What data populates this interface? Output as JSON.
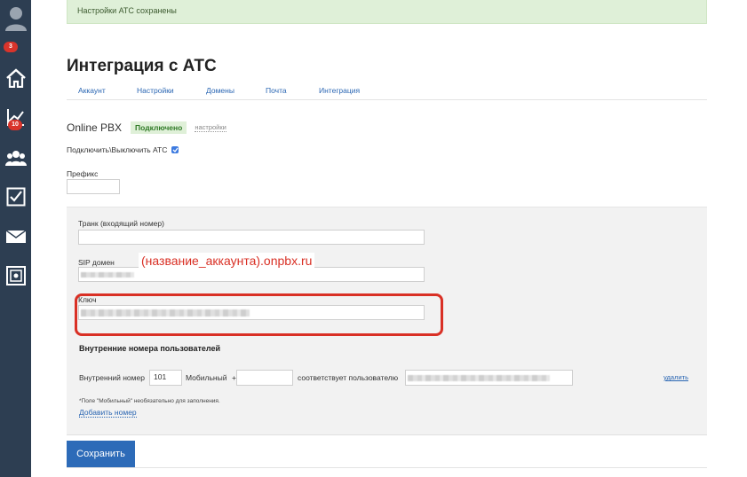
{
  "sidebar": {
    "items": [
      {
        "icon": "user-avatar-icon"
      },
      {
        "icon": "home-icon",
        "badge": "3"
      },
      {
        "icon": "chart-icon",
        "badge": "10"
      },
      {
        "icon": "users-icon"
      },
      {
        "icon": "tasks-checkbox-icon"
      },
      {
        "icon": "mail-icon"
      },
      {
        "icon": "safe-icon"
      }
    ],
    "colors": {
      "background": "#2d3e52",
      "badge": "#d9342b"
    }
  },
  "alert": {
    "text": "Настройки АТС сохранены"
  },
  "page": {
    "title": "Интеграция с АТС"
  },
  "tabs": [
    {
      "label": "Аккаунт"
    },
    {
      "label": "Настройки"
    },
    {
      "label": "Домены"
    },
    {
      "label": "Почта"
    },
    {
      "label": "Интеграция"
    }
  ],
  "pbx": {
    "name": "Online PBX",
    "status": "Подключено",
    "settings_link": "настройки"
  },
  "toggle": {
    "label": "Подключить\\Выключить АТС",
    "checked": true
  },
  "prefix": {
    "label": "Префикс",
    "value": ""
  },
  "trunk": {
    "label": "Транк (входящий номер)",
    "value": ""
  },
  "sip_domain": {
    "label": "SIP домен"
  },
  "annotation": {
    "text": "(название_аккаунта).onpbx.ru"
  },
  "key": {
    "label": "Ключ"
  },
  "internal": {
    "section_title": "Внутренние номера пользователей",
    "ext_label": "Внутренний номер",
    "ext_value": "101",
    "mobile_label": "Мобильный",
    "mobile_prefix": "+",
    "mobile_value": "",
    "matches_label": "соответствует пользователю",
    "remove_link": "удалить",
    "note": "*Поле \"Мобильный\" необязательно для заполнения.",
    "add_link": "Добавить номер"
  },
  "actions": {
    "save_label": "Сохранить"
  },
  "colors": {
    "accent": "#2d6bb8",
    "link": "#2a66b3",
    "success_bg": "#dff0d8",
    "annotation": "#d93025"
  }
}
